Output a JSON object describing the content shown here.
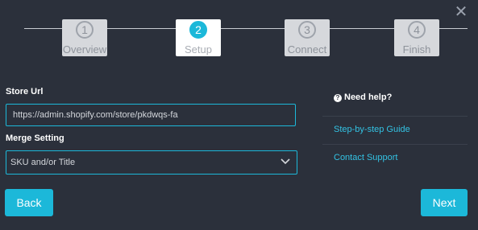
{
  "stepper": {
    "steps": [
      {
        "number": "1",
        "label": "Overview"
      },
      {
        "number": "2",
        "label": "Setup"
      },
      {
        "number": "3",
        "label": "Connect"
      },
      {
        "number": "4",
        "label": "Finish"
      }
    ],
    "active_step": "2"
  },
  "form": {
    "store_url_label": "Store Url",
    "store_url_value": "https://admin.shopify.com/store/pkdwqs-fa",
    "merge_setting_label": "Merge Setting",
    "merge_setting_value": "SKU and/or Title"
  },
  "help": {
    "title": "Need help?",
    "links": [
      "Step-by-step Guide",
      "Contact Support"
    ]
  },
  "buttons": {
    "back": "Back",
    "next": "Next"
  },
  "colors": {
    "background": "#2b303b",
    "accent": "#1cb8d9",
    "link": "#33c2e3"
  },
  "icons": {
    "close": "close-icon",
    "help": "question-circle-icon",
    "dropdown": "chevron-down-icon"
  }
}
